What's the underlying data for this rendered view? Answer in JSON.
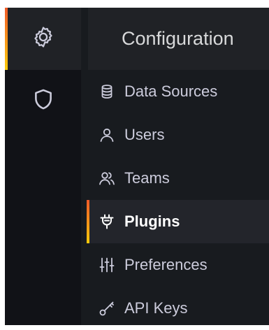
{
  "rail": {
    "items": [
      {
        "icon": "gear-icon",
        "active": true
      },
      {
        "icon": "shield-icon",
        "active": false
      }
    ]
  },
  "panel": {
    "title": "Configuration",
    "items": [
      {
        "label": "Data Sources",
        "icon": "database-icon",
        "active": false
      },
      {
        "label": "Users",
        "icon": "user-icon",
        "active": false
      },
      {
        "label": "Teams",
        "icon": "users-icon",
        "active": false
      },
      {
        "label": "Plugins",
        "icon": "plug-icon",
        "active": true
      },
      {
        "label": "Preferences",
        "icon": "sliders-icon",
        "active": false
      },
      {
        "label": "API Keys",
        "icon": "key-icon",
        "active": false
      }
    ]
  },
  "colors": {
    "rail_bg": "#111217",
    "panel_bg": "#181b1f",
    "active_bg": "#202226",
    "text": "#ccccdc",
    "accent_top": "#f05a28",
    "accent_bottom": "#fbca0a"
  }
}
